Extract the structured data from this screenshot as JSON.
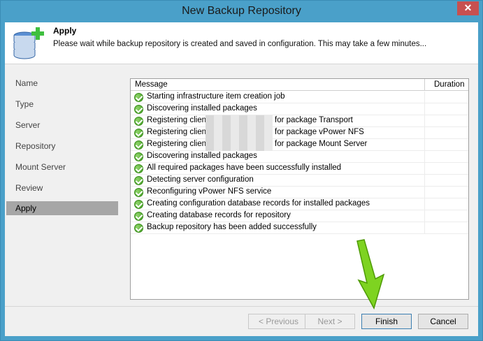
{
  "window": {
    "title": "New Backup Repository",
    "close_label": "✕"
  },
  "header": {
    "title": "Apply",
    "description": "Please wait while backup repository is created and saved in configuration. This may take a few minutes..."
  },
  "nav": {
    "items": [
      {
        "label": "Name",
        "active": false
      },
      {
        "label": "Type",
        "active": false
      },
      {
        "label": "Server",
        "active": false
      },
      {
        "label": "Repository",
        "active": false
      },
      {
        "label": "Mount Server",
        "active": false
      },
      {
        "label": "Review",
        "active": false
      },
      {
        "label": "Apply",
        "active": true
      }
    ]
  },
  "log": {
    "columns": {
      "message": "Message",
      "duration": "Duration"
    },
    "rows": [
      {
        "text": "Starting infrastructure item creation job",
        "suffix": ""
      },
      {
        "text": "Discovering installed packages",
        "suffix": ""
      },
      {
        "text": "Registering client",
        "suffix": "for package Transport"
      },
      {
        "text": "Registering client",
        "suffix": "for package vPower NFS"
      },
      {
        "text": "Registering client",
        "suffix": "for package Mount Server"
      },
      {
        "text": "Discovering installed packages",
        "suffix": ""
      },
      {
        "text": "All required packages have been successfully installed",
        "suffix": ""
      },
      {
        "text": "Detecting server configuration",
        "suffix": ""
      },
      {
        "text": "Reconfiguring vPower NFS service",
        "suffix": ""
      },
      {
        "text": "Creating configuration database records for installed packages",
        "suffix": ""
      },
      {
        "text": "Creating database records for repository",
        "suffix": ""
      },
      {
        "text": "Backup repository has been added successfully",
        "suffix": ""
      }
    ]
  },
  "buttons": {
    "previous": "< Previous",
    "next": "Next >",
    "finish": "Finish",
    "cancel": "Cancel"
  },
  "colors": {
    "titlebar": "#4aa0c9",
    "success": "#3e9a1f",
    "arrow": "#7ed321"
  }
}
